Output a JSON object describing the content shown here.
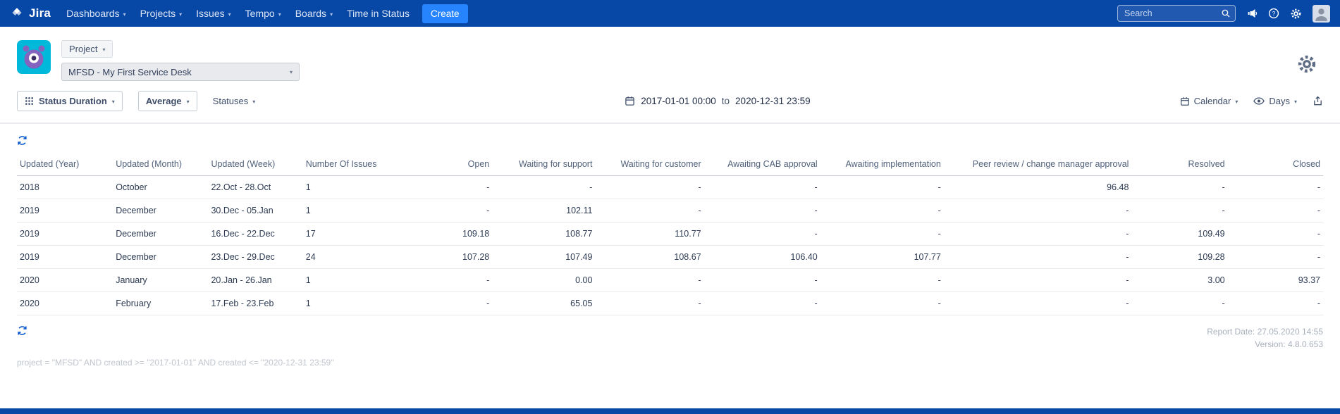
{
  "colors": {
    "navbar": "#0747A6",
    "create": "#2684FF",
    "accent": "#0052CC"
  },
  "navbar": {
    "logo_text": "Jira",
    "items": [
      {
        "label": "Dashboards",
        "chevron": true
      },
      {
        "label": "Projects",
        "chevron": true
      },
      {
        "label": "Issues",
        "chevron": true
      },
      {
        "label": "Tempo",
        "chevron": true
      },
      {
        "label": "Boards",
        "chevron": true
      },
      {
        "label": "Time in Status",
        "chevron": false
      }
    ],
    "create_label": "Create",
    "search_placeholder": "Search"
  },
  "header": {
    "project_button_label": "Project",
    "project_select_value": "MFSD - My First Service Desk"
  },
  "toolbar": {
    "report_type_label": "Status Duration",
    "aggregation_label": "Average",
    "statuses_label": "Statuses",
    "date_from": "2017-01-01 00:00",
    "date_separator": "to",
    "date_to": "2020-12-31 23:59",
    "calendar_label": "Calendar",
    "unit_label": "Days"
  },
  "table": {
    "columns": [
      "Updated (Year)",
      "Updated (Month)",
      "Updated (Week)",
      "Number Of Issues",
      "Open",
      "Waiting for support",
      "Waiting for customer",
      "Awaiting CAB approval",
      "Awaiting implementation",
      "Peer review / change manager approval",
      "Resolved",
      "Closed"
    ],
    "rows": [
      [
        "2018",
        "October",
        "22.Oct - 28.Oct",
        "1",
        "-",
        "-",
        "-",
        "-",
        "-",
        "96.48",
        "-",
        "-"
      ],
      [
        "2019",
        "December",
        "30.Dec - 05.Jan",
        "1",
        "-",
        "102.11",
        "-",
        "-",
        "-",
        "-",
        "-",
        "-"
      ],
      [
        "2019",
        "December",
        "16.Dec - 22.Dec",
        "17",
        "109.18",
        "108.77",
        "110.77",
        "-",
        "-",
        "-",
        "109.49",
        "-"
      ],
      [
        "2019",
        "December",
        "23.Dec - 29.Dec",
        "24",
        "107.28",
        "107.49",
        "108.67",
        "106.40",
        "107.77",
        "-",
        "109.28",
        "-"
      ],
      [
        "2020",
        "January",
        "20.Jan - 26.Jan",
        "1",
        "-",
        "0.00",
        "-",
        "-",
        "-",
        "-",
        "3.00",
        "93.37"
      ],
      [
        "2020",
        "February",
        "17.Feb - 23.Feb",
        "1",
        "-",
        "65.05",
        "-",
        "-",
        "-",
        "-",
        "-",
        "-"
      ]
    ]
  },
  "footer": {
    "report_date": "Report Date: 27.05.2020 14:55",
    "version": "Version: 4.8.0.653",
    "query": "project = \"MFSD\" AND created >= \"2017-01-01\" AND created <= \"2020-12-31 23:59\""
  }
}
